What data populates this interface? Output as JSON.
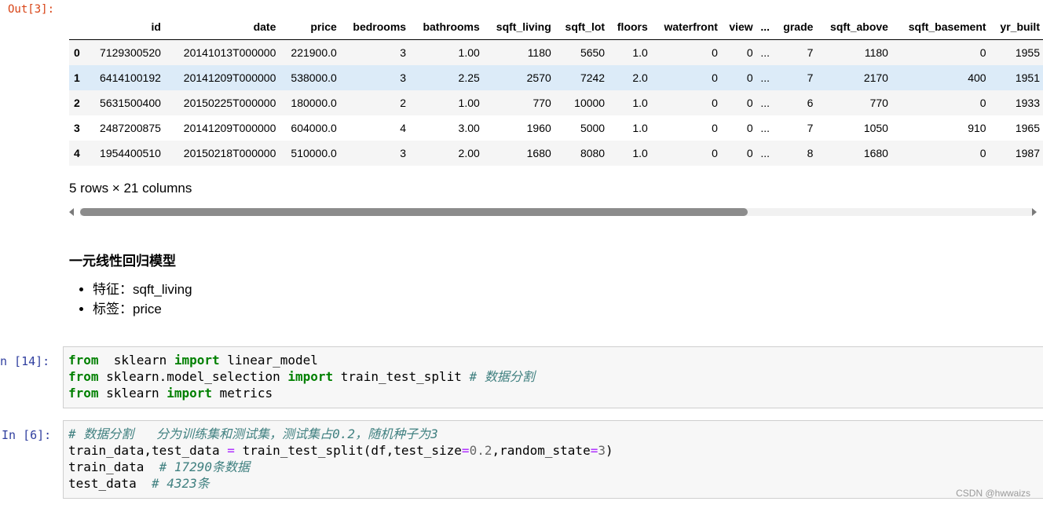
{
  "output_prompt": "Out[3]:",
  "table": {
    "columns": [
      "",
      "id",
      "date",
      "price",
      "bedrooms",
      "bathrooms",
      "sqft_living",
      "sqft_lot",
      "floors",
      "waterfront",
      "view",
      "...",
      "grade",
      "sqft_above",
      "sqft_basement",
      "yr_built"
    ],
    "rows": [
      [
        "0",
        "7129300520",
        "20141013T000000",
        "221900.0",
        "3",
        "1.00",
        "1180",
        "5650",
        "1.0",
        "0",
        "0",
        "...",
        "7",
        "1180",
        "0",
        "1955"
      ],
      [
        "1",
        "6414100192",
        "20141209T000000",
        "538000.0",
        "3",
        "2.25",
        "2570",
        "7242",
        "2.0",
        "0",
        "0",
        "...",
        "7",
        "2170",
        "400",
        "1951"
      ],
      [
        "2",
        "5631500400",
        "20150225T000000",
        "180000.0",
        "2",
        "1.00",
        "770",
        "10000",
        "1.0",
        "0",
        "0",
        "...",
        "6",
        "770",
        "0",
        "1933"
      ],
      [
        "3",
        "2487200875",
        "20141209T000000",
        "604000.0",
        "4",
        "3.00",
        "1960",
        "5000",
        "1.0",
        "0",
        "0",
        "...",
        "7",
        "1050",
        "910",
        "1965"
      ],
      [
        "4",
        "1954400510",
        "20150218T000000",
        "510000.0",
        "3",
        "2.00",
        "1680",
        "8080",
        "1.0",
        "0",
        "0",
        "...",
        "8",
        "1680",
        "0",
        "1987"
      ]
    ],
    "summary": "5 rows × 21 columns"
  },
  "markdown": {
    "title": "一元线性回归模型",
    "items": [
      "特征：sqft_living",
      "标签：price"
    ]
  },
  "cells": [
    {
      "prompt": "n  [14]:",
      "lines": [
        [
          [
            "kw",
            "from"
          ],
          [
            "",
            "  sklearn "
          ],
          [
            "kw",
            "import"
          ],
          [
            "",
            " linear_model"
          ]
        ],
        [
          [
            "kw",
            "from"
          ],
          [
            "",
            " sklearn.model_selection "
          ],
          [
            "kw",
            "import"
          ],
          [
            "",
            " train_test_split "
          ],
          [
            "cm",
            "# 数据分割"
          ]
        ],
        [
          [
            "kw",
            "from"
          ],
          [
            "",
            " sklearn "
          ],
          [
            "kw",
            "import"
          ],
          [
            "",
            " metrics"
          ]
        ]
      ]
    },
    {
      "prompt": "In  [6]:",
      "lines": [
        [
          [
            "cm",
            "# 数据分割   分为训练集和测试集，测试集占0.2，随机种子为3"
          ]
        ],
        [
          [
            "",
            "train_data,test_data "
          ],
          [
            "op",
            "="
          ],
          [
            "",
            " train_test_split(df,test_size"
          ],
          [
            "op",
            "="
          ],
          [
            "nm",
            "0.2"
          ],
          [
            "",
            ",random_state"
          ],
          [
            "op",
            "="
          ],
          [
            "nm",
            "3"
          ],
          [
            "",
            ")"
          ]
        ],
        [
          [
            "",
            "train_data  "
          ],
          [
            "cm",
            "# 17290条数据"
          ]
        ],
        [
          [
            "",
            "test_data  "
          ],
          [
            "cm",
            "# 4323条"
          ]
        ]
      ]
    }
  ],
  "watermark": "CSDN @hwwaizs"
}
